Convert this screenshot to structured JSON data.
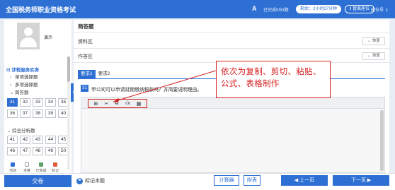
{
  "header": {
    "title": "全国税务师职业资格考试",
    "font_icon": "A",
    "done_count": "已完成0/53题",
    "timer": "剩余：2小时27分钟",
    "pause_label": "‖ 暂离座位",
    "seat_label": "座位号",
    "seat_value": "1"
  },
  "sidebar": {
    "name": "演示",
    "subject": "涉税服务实务",
    "categories": [
      {
        "label": "单项选择题",
        "arrow": "›"
      },
      {
        "label": "多项选择题",
        "arrow": "›"
      },
      {
        "label": "简答题",
        "arrow": "⌄"
      }
    ],
    "short_answer_numbers": [
      "31",
      "32",
      "33",
      "34",
      "35",
      "36",
      "37",
      "38",
      "39",
      "40"
    ],
    "composite_label": "综合分析题",
    "composite_numbers": [
      "41",
      "42",
      "43",
      "44",
      "45",
      "46",
      "47",
      "48",
      "49",
      "50"
    ],
    "legend": [
      {
        "label": "当前",
        "color": "#2d6fd3"
      },
      {
        "label": "未答",
        "color": "#ffffff"
      },
      {
        "label": "已完成",
        "color": "#5aa469"
      },
      {
        "label": "标记",
        "color": "#e05a3a"
      }
    ]
  },
  "main": {
    "heading": "简答题",
    "material_label": "资料区",
    "answer_label": "作答区",
    "restore_label": "↔ 恢复",
    "tabs": [
      "要求1",
      "要求2"
    ],
    "question_number": "31",
    "question_text": "甲公司可以申请延期缴纳税款吗？并简要说明理由。",
    "toolbar_icons": [
      "copy-icon",
      "cut-icon",
      "paste-icon",
      "formula-icon",
      "table-icon"
    ],
    "toolbar_glyphs": [
      "⊞",
      "✂",
      "⧉",
      "√x",
      "▦"
    ]
  },
  "annotation": {
    "text": "依次为复制、剪切、粘贴、公式、表格制作",
    "color": "#d62020"
  },
  "footer": {
    "submit_label": "交卷",
    "mark_label": "标记本题",
    "calculator_label": "计算器",
    "attachment_label": "附表",
    "prev_label": "◀ 上一页",
    "next_label": "下一页 ▶"
  },
  "colors": {
    "accent": "#2d6fd3",
    "annotation_red": "#d62020"
  }
}
